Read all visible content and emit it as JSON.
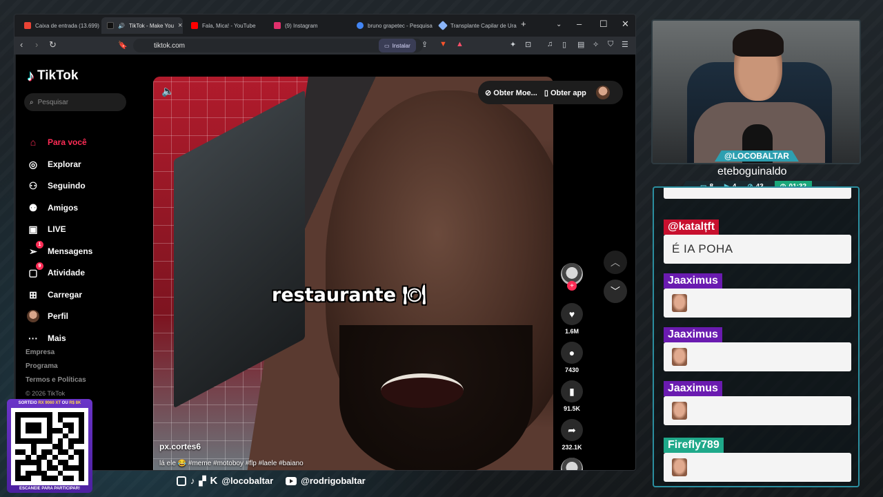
{
  "browser": {
    "tabs": [
      {
        "label": "Caixa de entrada (13.699)",
        "color": "#ea4335"
      },
      {
        "label": "TikTok - Make You",
        "color": "#ffffff",
        "active": true
      },
      {
        "label": "Fala, Mica! - YouTube",
        "color": "#ff0000"
      },
      {
        "label": "(9) Instagram",
        "color": "#e1306c"
      },
      {
        "label": "bruno grapetec - Pesquisa",
        "color": "#4285f4"
      },
      {
        "label": "Transplante Capilar de Ura",
        "color": "#8ab4f8"
      }
    ],
    "url": "tiktok.com",
    "install_label": "Instalar"
  },
  "tiktok": {
    "logo": "TikTok",
    "search_placeholder": "Pesquisar",
    "nav": [
      {
        "label": "Para você",
        "icon": "home-icon",
        "active": true
      },
      {
        "label": "Explorar",
        "icon": "compass-icon"
      },
      {
        "label": "Seguindo",
        "icon": "following-icon"
      },
      {
        "label": "Amigos",
        "icon": "friends-icon"
      },
      {
        "label": "LIVE",
        "icon": "live-icon"
      },
      {
        "label": "Mensagens",
        "icon": "messages-icon",
        "badge": "1"
      },
      {
        "label": "Atividade",
        "icon": "activity-icon",
        "badge": "9"
      },
      {
        "label": "Carregar",
        "icon": "upload-icon"
      },
      {
        "label": "Perfil",
        "icon": "profile-avatar"
      },
      {
        "label": "Mais",
        "icon": "more-icon"
      }
    ],
    "footer": [
      "Empresa",
      "Programa",
      "Termos e Políticas"
    ],
    "copyright": "© 2026 TikTok",
    "top_pill": {
      "coins": "Obter Moe...",
      "app": "Obter app"
    },
    "video": {
      "caption_word": "restaurante",
      "username": "px.cortes6",
      "description": "lá ele 😂 #meme #motoboy #flp #laele #baiano",
      "progress": 0.17
    },
    "actions": {
      "likes": "1.6M",
      "comments": "7430",
      "saves": "91.5K",
      "shares": "232.1K"
    }
  },
  "overlay": {
    "handle": "@LOCOBALTAR",
    "cam_name": "eteboguinaldo",
    "stats": {
      "chat": "8",
      "video": "4",
      "viewers": "43",
      "time": "01:32"
    },
    "chat": [
      {
        "user": "@katalțft",
        "text": "É IA POHA",
        "color": "#c8102e"
      },
      {
        "user": "Jaaximus",
        "emote": true,
        "color": "#6a1bb0"
      },
      {
        "user": "Jaaximus",
        "emote": true,
        "color": "#6a1bb0"
      },
      {
        "user": "Jaaximus",
        "emote": true,
        "color": "#6a1bb0"
      },
      {
        "user": "Firefly789",
        "emote": true,
        "color": "#1fa98a"
      }
    ],
    "qr": {
      "top_prefix": "SORTEIO",
      "top_a": "RX 9060 XT",
      "top_mid": "OU",
      "top_b": "R$ 8K",
      "bottom": "ESCANEIE PARA PARTICIPAR!"
    },
    "socials": {
      "handle1": "@locobaltar",
      "handle2": "@rodrigobaltar"
    }
  }
}
